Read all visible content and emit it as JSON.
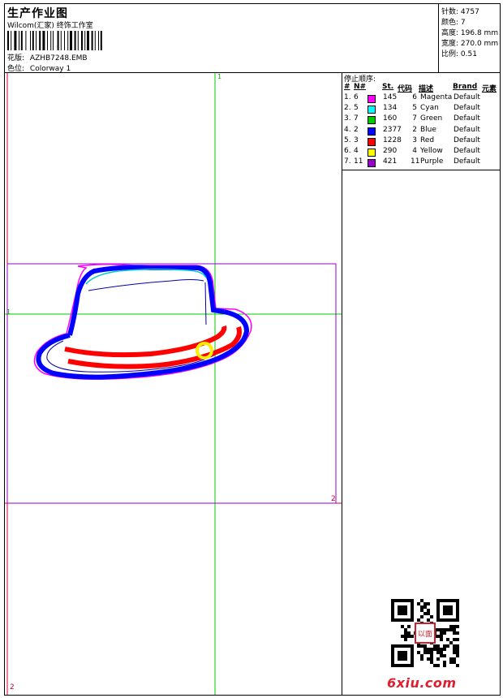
{
  "header": {
    "title": "生产作业图",
    "subtitle": "Wilcom(汇家) 终饰工作室",
    "design_label": "花版:",
    "design_value": "AZHB7248.EMB",
    "colorway_label": "色位:",
    "colorway_value": "Colorway 1"
  },
  "stats": {
    "stitches_label": "针数:",
    "stitches_value": "4757",
    "colors_label": "颜色:",
    "colors_value": "7",
    "height_label": "高度:",
    "height_value": "196.8 mm",
    "width_label": "宽度:",
    "width_value": "270.0 mm",
    "scale_label": "比例:",
    "scale_value": "0.51"
  },
  "canvas": {
    "marker_top": "1",
    "marker_left": "1",
    "marker_box_corner": "2",
    "marker_bottom_left": "2"
  },
  "stop_sequence": {
    "title": "停止顺序:",
    "columns": [
      "#",
      "N#",
      "St.",
      "代码",
      "描述",
      "Brand",
      "元素"
    ],
    "rows": [
      {
        "idx": "1.",
        "n": "6",
        "st": "145",
        "code": "6",
        "desc": "Magenta",
        "brand": "Default",
        "color": "#ff00ff"
      },
      {
        "idx": "2.",
        "n": "5",
        "st": "134",
        "code": "5",
        "desc": "Cyan",
        "brand": "Default",
        "color": "#00ffff"
      },
      {
        "idx": "3.",
        "n": "7",
        "st": "160",
        "code": "7",
        "desc": "Green",
        "brand": "Default",
        "color": "#00cc00"
      },
      {
        "idx": "4.",
        "n": "2",
        "st": "2377",
        "code": "2",
        "desc": "Blue",
        "brand": "Default",
        "color": "#0000ff"
      },
      {
        "idx": "5.",
        "n": "3",
        "st": "1228",
        "code": "3",
        "desc": "Red",
        "brand": "Default",
        "color": "#ff0000"
      },
      {
        "idx": "6.",
        "n": "4",
        "st": "290",
        "code": "4",
        "desc": "Yellow",
        "brand": "Default",
        "color": "#ffff00"
      },
      {
        "idx": "7.",
        "n": "11",
        "st": "421",
        "code": "11",
        "desc": "Purple",
        "brand": "Default",
        "color": "#9900cc"
      }
    ]
  },
  "watermark": {
    "logo_text": "6xiu",
    "logo_suffix": ".com",
    "qr_icon": "qr-code-icon",
    "seal_text": "以面图秀"
  }
}
